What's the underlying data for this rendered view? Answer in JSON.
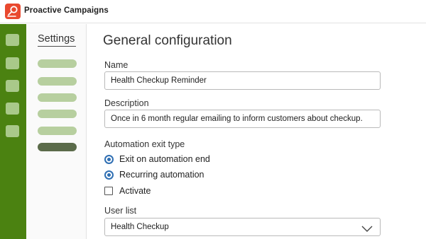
{
  "app": {
    "title": "Proactive Campaigns",
    "logo_icon": "campaign-pin-icon",
    "brand_color": "#e9492f"
  },
  "rail": {
    "color": "#4b8211",
    "buttons": [
      "nav-placeholder",
      "nav-placeholder",
      "nav-placeholder",
      "nav-placeholder",
      "nav-placeholder"
    ]
  },
  "settings": {
    "title": "Settings",
    "items": [
      {
        "placeholder": true,
        "active": false
      },
      {
        "placeholder": true,
        "active": false
      },
      {
        "placeholder": true,
        "active": false
      },
      {
        "placeholder": true,
        "active": false
      },
      {
        "placeholder": true,
        "active": false
      },
      {
        "placeholder": true,
        "active": true
      }
    ]
  },
  "form": {
    "title": "General configuration",
    "name": {
      "label": "Name",
      "value": "Health Checkup Reminder"
    },
    "description": {
      "label": "Description",
      "value": "Once in 6 month regular emailing to inform customers about checkup."
    },
    "exit_type": {
      "label": "Automation exit type",
      "options": [
        {
          "label": "Exit on automation end",
          "type": "radio",
          "selected": true
        },
        {
          "label": "Recurring automation",
          "type": "radio",
          "selected": true
        },
        {
          "label": "Activate",
          "type": "checkbox",
          "checked": false
        }
      ]
    },
    "user_list": {
      "label": "User list",
      "value": "Health Checkup",
      "icon": "chevron-down-icon"
    }
  },
  "colors": {
    "accent_radio": "#2f6fb3",
    "nav_pill": "#b7cf9f",
    "nav_pill_active": "#5b6b4a"
  }
}
